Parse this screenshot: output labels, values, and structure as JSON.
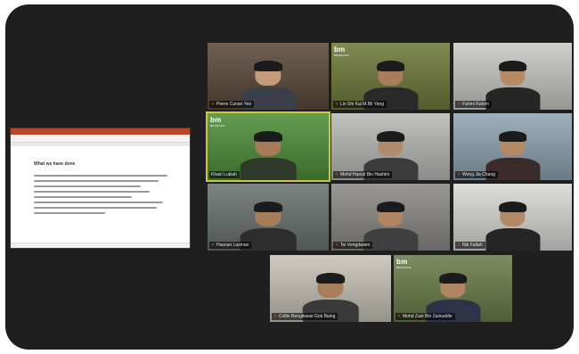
{
  "shared_screen": {
    "slide_title": "What we have done"
  },
  "participants": [
    {
      "name": "Pierre Cunan Yeo",
      "bg": "#5b4a3a",
      "shirt": "#3a3f4a",
      "skin": "#c49a78",
      "muted": true
    },
    {
      "name": "Lin Shi Kai M.Bil Yang",
      "bg": "#6f7a3b",
      "shirt": "#2a2a2a",
      "skin": "#a97d5c",
      "muted": true,
      "logo": "bm"
    },
    {
      "name": "Fahmi Rahim",
      "bg": "#c9c9c5",
      "shirt": "#262626",
      "skin": "#b58a64",
      "muted": true
    },
    {
      "name": "Khairi Lukiah",
      "bg": "#4f8f3a",
      "shirt": "#2f3a2a",
      "skin": "#a57b58",
      "muted": false,
      "logo": "bm",
      "active": true
    },
    {
      "name": "Mohd Hasrol Bin Hashim",
      "bg": "#b9b9b6",
      "shirt": "#3b3b3b",
      "skin": "#b08a6a",
      "muted": true
    },
    {
      "name": "Wong Jia Chang",
      "bg": "#8fa5b3",
      "shirt": "#3a2a2a",
      "skin": "#b38865",
      "muted": true
    },
    {
      "name": "Hasnan Lasman",
      "bg": "#6b7370",
      "shirt": "#2d2d2d",
      "skin": "#a67e5c",
      "muted": true
    },
    {
      "name": "Tei Vengdaram",
      "bg": "#8b8a86",
      "shirt": "#3f3f3f",
      "skin": "#b08564",
      "muted": true
    },
    {
      "name": "Nik Fattah",
      "bg": "#d9d9d7",
      "shirt": "#252525",
      "skin": "#b48a66",
      "muted": true
    },
    {
      "name": "Collin Rengikwan Gok Baing",
      "bg": "#c7c3b8",
      "shirt": "#3a3a3a",
      "skin": "#a87e5b",
      "muted": true
    },
    {
      "name": "Mohd Zairi Bin Zainuddin",
      "bg": "#6b7d4a",
      "shirt": "#2e3348",
      "skin": "#b08562",
      "muted": true,
      "logo": "bm"
    }
  ],
  "logo": {
    "text": "bm",
    "sub": "BERNAMA"
  }
}
